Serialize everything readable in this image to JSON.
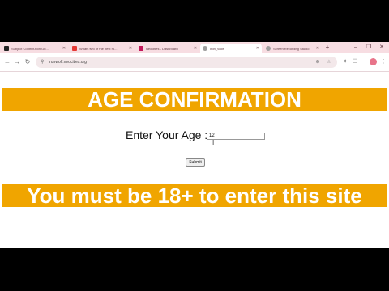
{
  "browser": {
    "tabs": [
      {
        "label": "Subject Contribution Gu...",
        "icon_color": "#222222"
      },
      {
        "label": "Whats two of the best ro...",
        "icon_color": "#e53935"
      },
      {
        "label": "Neocities - Dashboard",
        "icon_color": "#c2185b"
      },
      {
        "label": "Iron_Wolf",
        "icon_color": "#9e9e9e"
      },
      {
        "label": "Screen Recording Studio",
        "icon_color": "#9e9e9e"
      }
    ],
    "active_tab_index": 3,
    "url": "ironwolf.neocities.org",
    "new_tab_label": "+"
  },
  "page": {
    "title": "AGE CONFIRMATION",
    "age_label": "Enter Your Age :",
    "age_value": "12",
    "submit_label": "Submit",
    "warning": "You must be 18+ to enter this site",
    "banner_color": "#f0a500"
  }
}
